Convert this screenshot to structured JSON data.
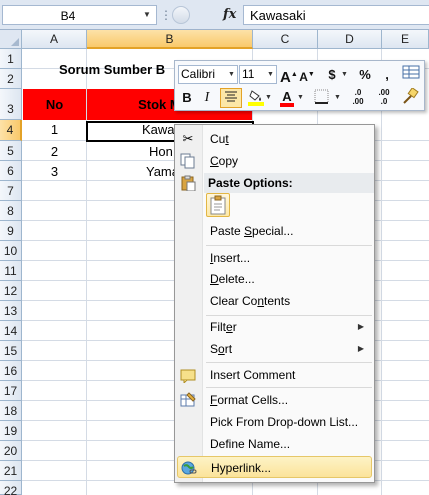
{
  "formula_bar": {
    "name_box": "B4",
    "fx_label": "fx",
    "formula_value": "Kawasaki"
  },
  "columns": [
    "A",
    "B",
    "C",
    "D",
    "E"
  ],
  "rows": [
    "1",
    "2",
    "3",
    "4",
    "5",
    "6",
    "7",
    "8",
    "9",
    "10",
    "11",
    "12",
    "13",
    "14",
    "15",
    "16",
    "17",
    "18",
    "19",
    "20",
    "21",
    "22"
  ],
  "cells": {
    "title": "Sorum Sumber B",
    "header_no": "No",
    "header_stok": "Stok Moto",
    "row4_no": "1",
    "row4_name": "Kawa",
    "row5_no": "2",
    "row5_name": "Hon",
    "row6_no": "3",
    "row6_name": "Yama"
  },
  "mini_toolbar": {
    "font_name": "Calibri",
    "font_size": "11",
    "grow_font": "A",
    "shrink_font": "A",
    "currency": "$",
    "percent": "%",
    "comma": ",",
    "bold": "B",
    "italic": "I",
    "font_color_label": "A",
    "increase_decimal": ".0\n.00",
    "decrease_decimal": ".00\n.0"
  },
  "context_menu": {
    "items": [
      {
        "label": "Cut",
        "underline": "t"
      },
      {
        "label": "Copy",
        "underline": "C"
      },
      {
        "label": "Paste Options:"
      },
      {
        "label": "Paste Special...",
        "underline": "S"
      },
      {
        "label": "Insert...",
        "underline": "I"
      },
      {
        "label": "Delete...",
        "underline": "D"
      },
      {
        "label": "Clear Contents",
        "underline": "n"
      },
      {
        "label": "Filter",
        "underline": "e"
      },
      {
        "label": "Sort",
        "underline": "o"
      },
      {
        "label": "Insert Comment",
        "underline": "M"
      },
      {
        "label": "Format Cells...",
        "underline": "F"
      },
      {
        "label": "Pick From Drop-down List...",
        "underline": "K"
      },
      {
        "label": "Define Name...",
        "underline": "A"
      },
      {
        "label": "Hyperlink...",
        "underline": "I"
      }
    ]
  },
  "colors": {
    "header_red": "#ff0000",
    "selection_orange": "#f9c96b",
    "menu_highlight": "#fbe39a"
  }
}
